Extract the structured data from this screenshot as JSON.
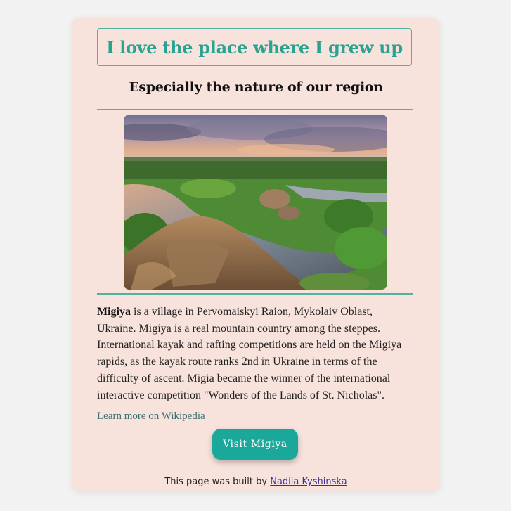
{
  "header": {
    "title": "I love the place where I grew up",
    "subtitle": "Especially the nature of our region"
  },
  "image": {
    "description": "Migiya rapids: river winding through green forested banks with rocky granite outcrop in foreground under cloudy sunset sky"
  },
  "article": {
    "bold_name": "Migiya",
    "text": " is a village in Pervomaiskyi Raion, Mykolaiv Oblast, Ukraine. Migiya is a real mountain country among the steppes. International kayak and rafting competitions are held on the Migiya rapids, as the kayak route ranks 2nd in Ukraine in terms of the difficulty of ascent. Migia became the winner of the international interactive competition \"Wonders of the Lands of St. Nicholas\".",
    "link_label": "Learn more on Wikipedia"
  },
  "button": {
    "label": "Visit Migiya"
  },
  "footer": {
    "prefix": "This page was built by ",
    "author": "Nadiia Kyshinska"
  },
  "colors": {
    "page_background": "#f2f2f2",
    "card_background": "#f7e2dc",
    "accent": "#27a391",
    "button": "#1aa89a",
    "link": "#3b6f73"
  }
}
